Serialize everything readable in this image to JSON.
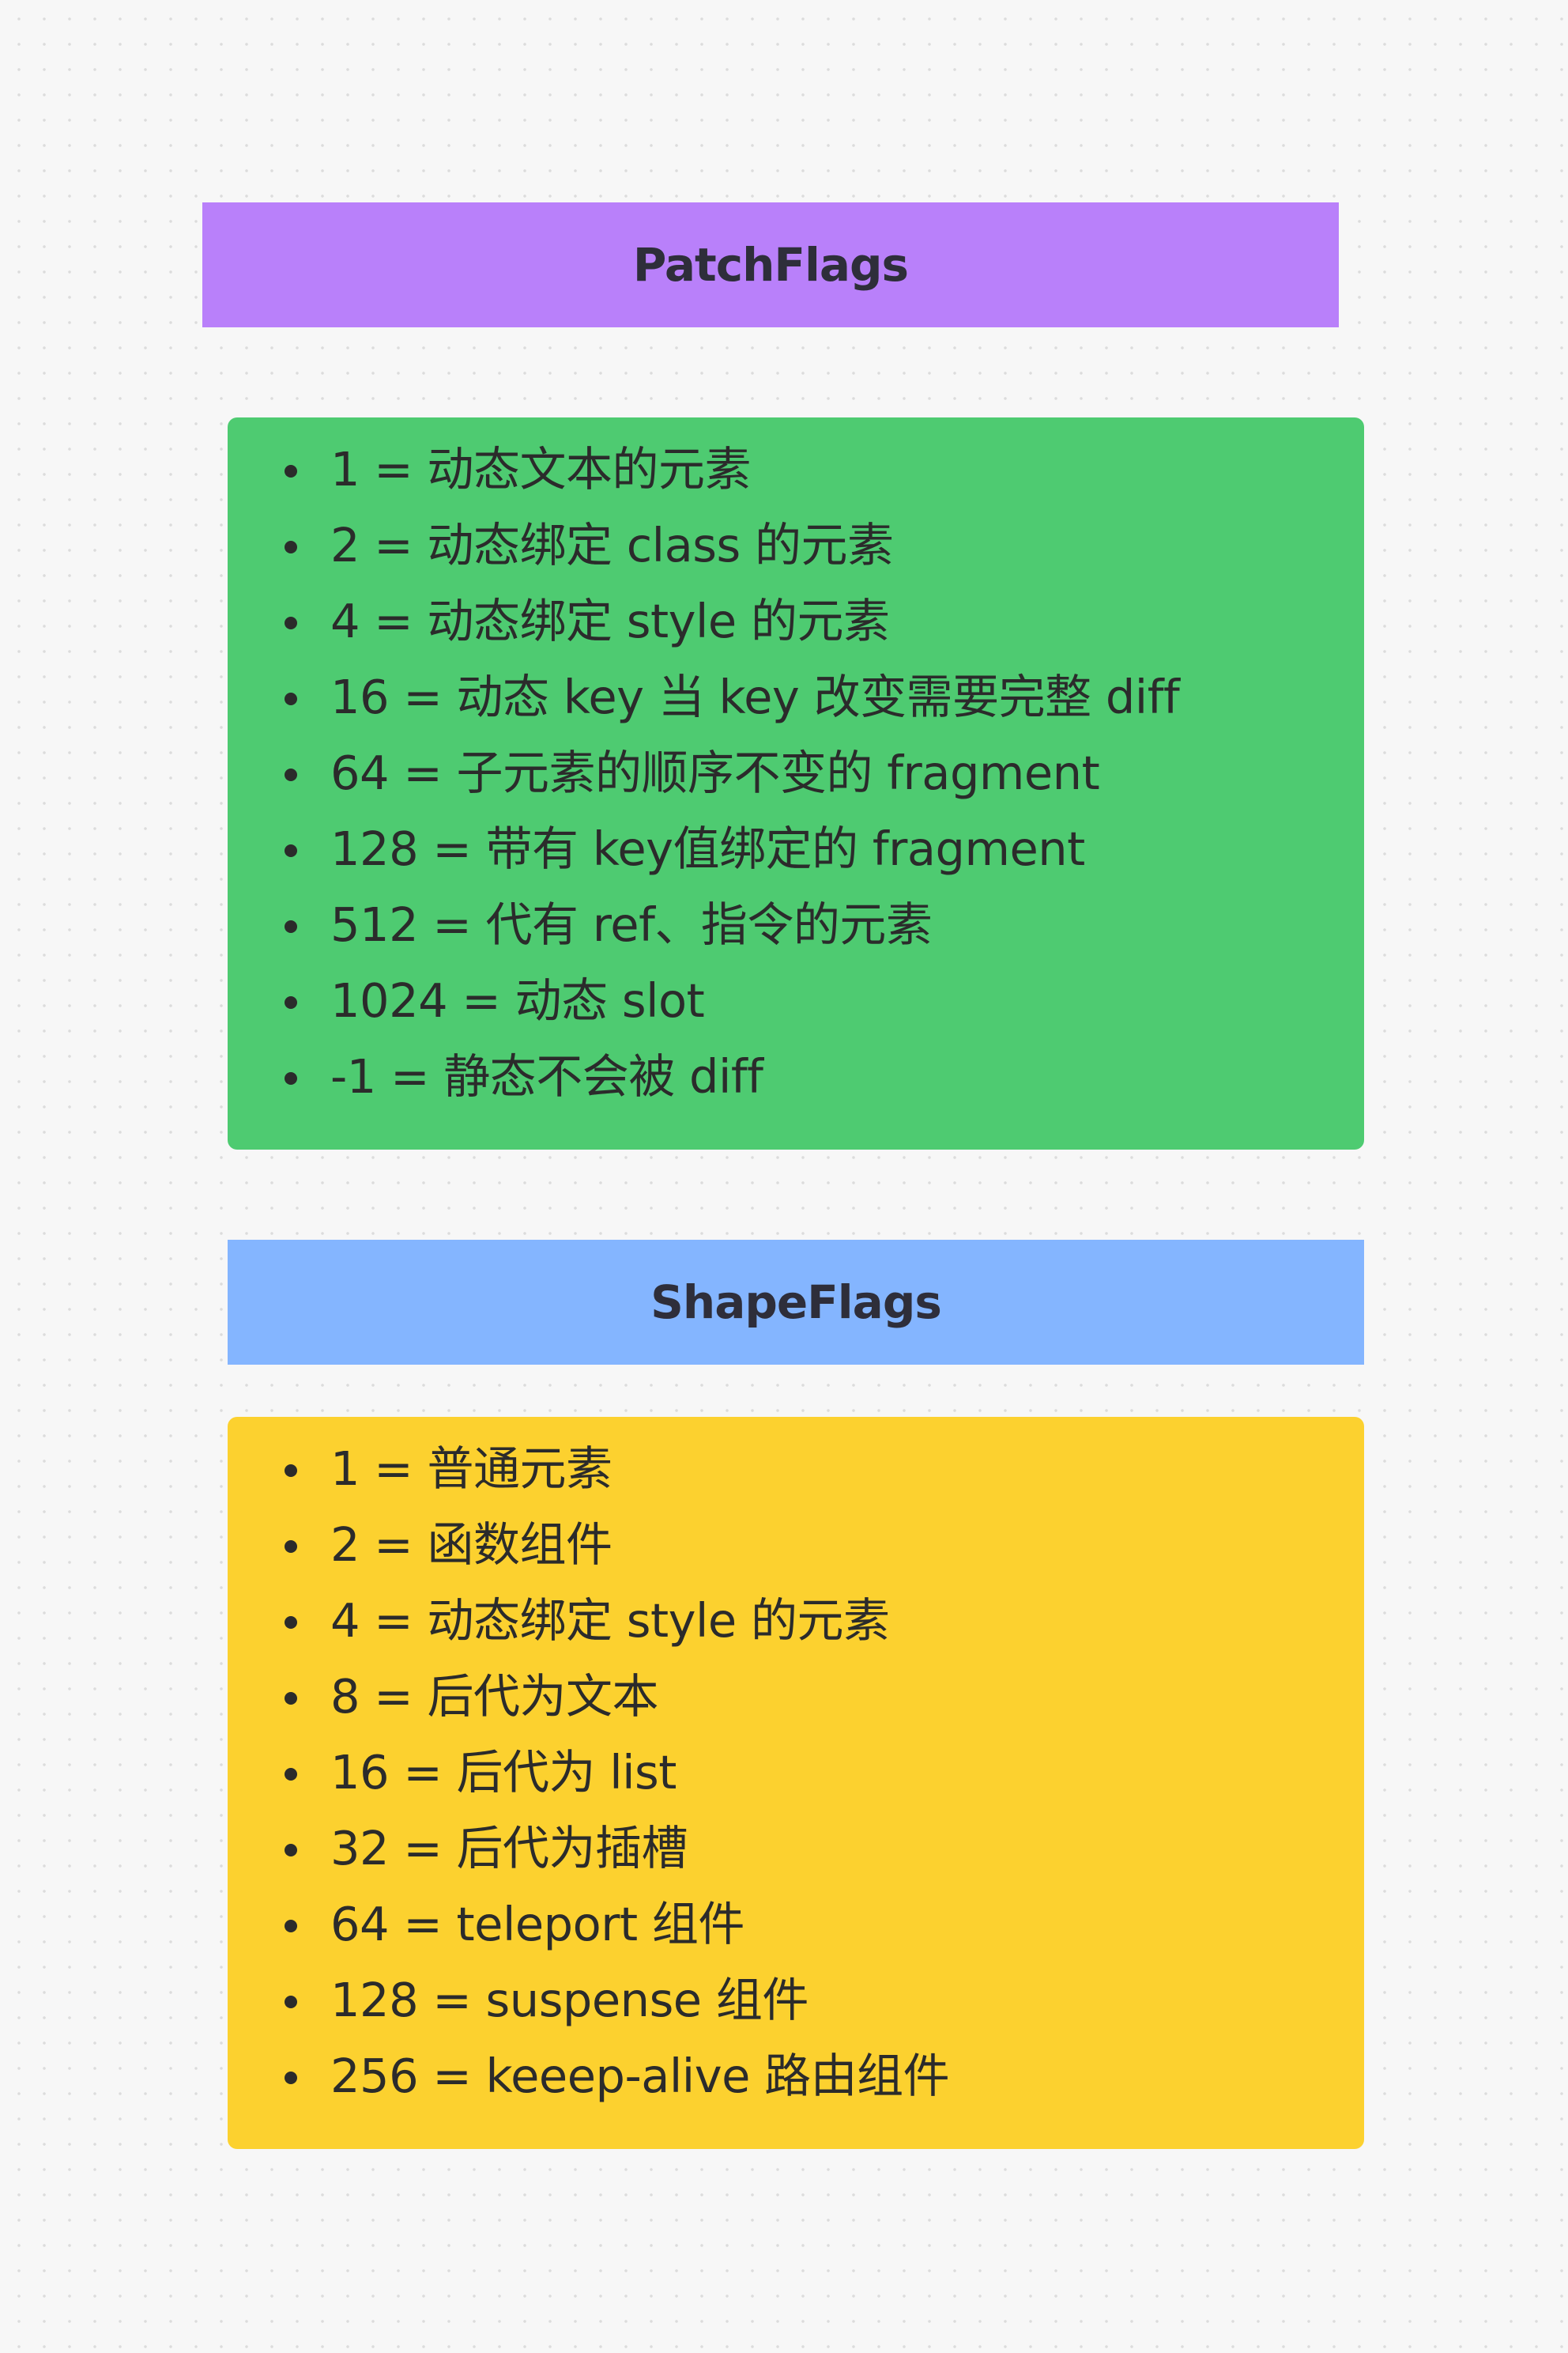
{
  "patch_flags": {
    "title": "PatchFlags",
    "color": "#b980fa",
    "list_color": "#4ecb71",
    "items": [
      "1 = 动态文本的元素",
      "2 = 动态绑定 class 的元素",
      "4 = 动态绑定 style 的元素",
      "16 = 动态 key 当 key 改变需要完整 diff",
      "64 = 子元素的顺序不变的 fragment",
      "128 = 带有 key值绑定的 fragment",
      "512 = 代有 ref、指令的元素",
      "1024 = 动态 slot",
      "-1 = 静态不会被 diff"
    ]
  },
  "shape_flags": {
    "title": "ShapeFlags",
    "color": "#84b5ff",
    "list_color": "#fcd12f",
    "items": [
      "1 = 普通元素",
      "2 = 函数组件",
      "4 = 动态绑定 style 的元素",
      "8 = 后代为文本",
      "16 = 后代为 list",
      "32 = 后代为插槽",
      "64 = teleport 组件",
      "128 = suspense 组件",
      "256 = keeep-alive 路由组件"
    ]
  }
}
